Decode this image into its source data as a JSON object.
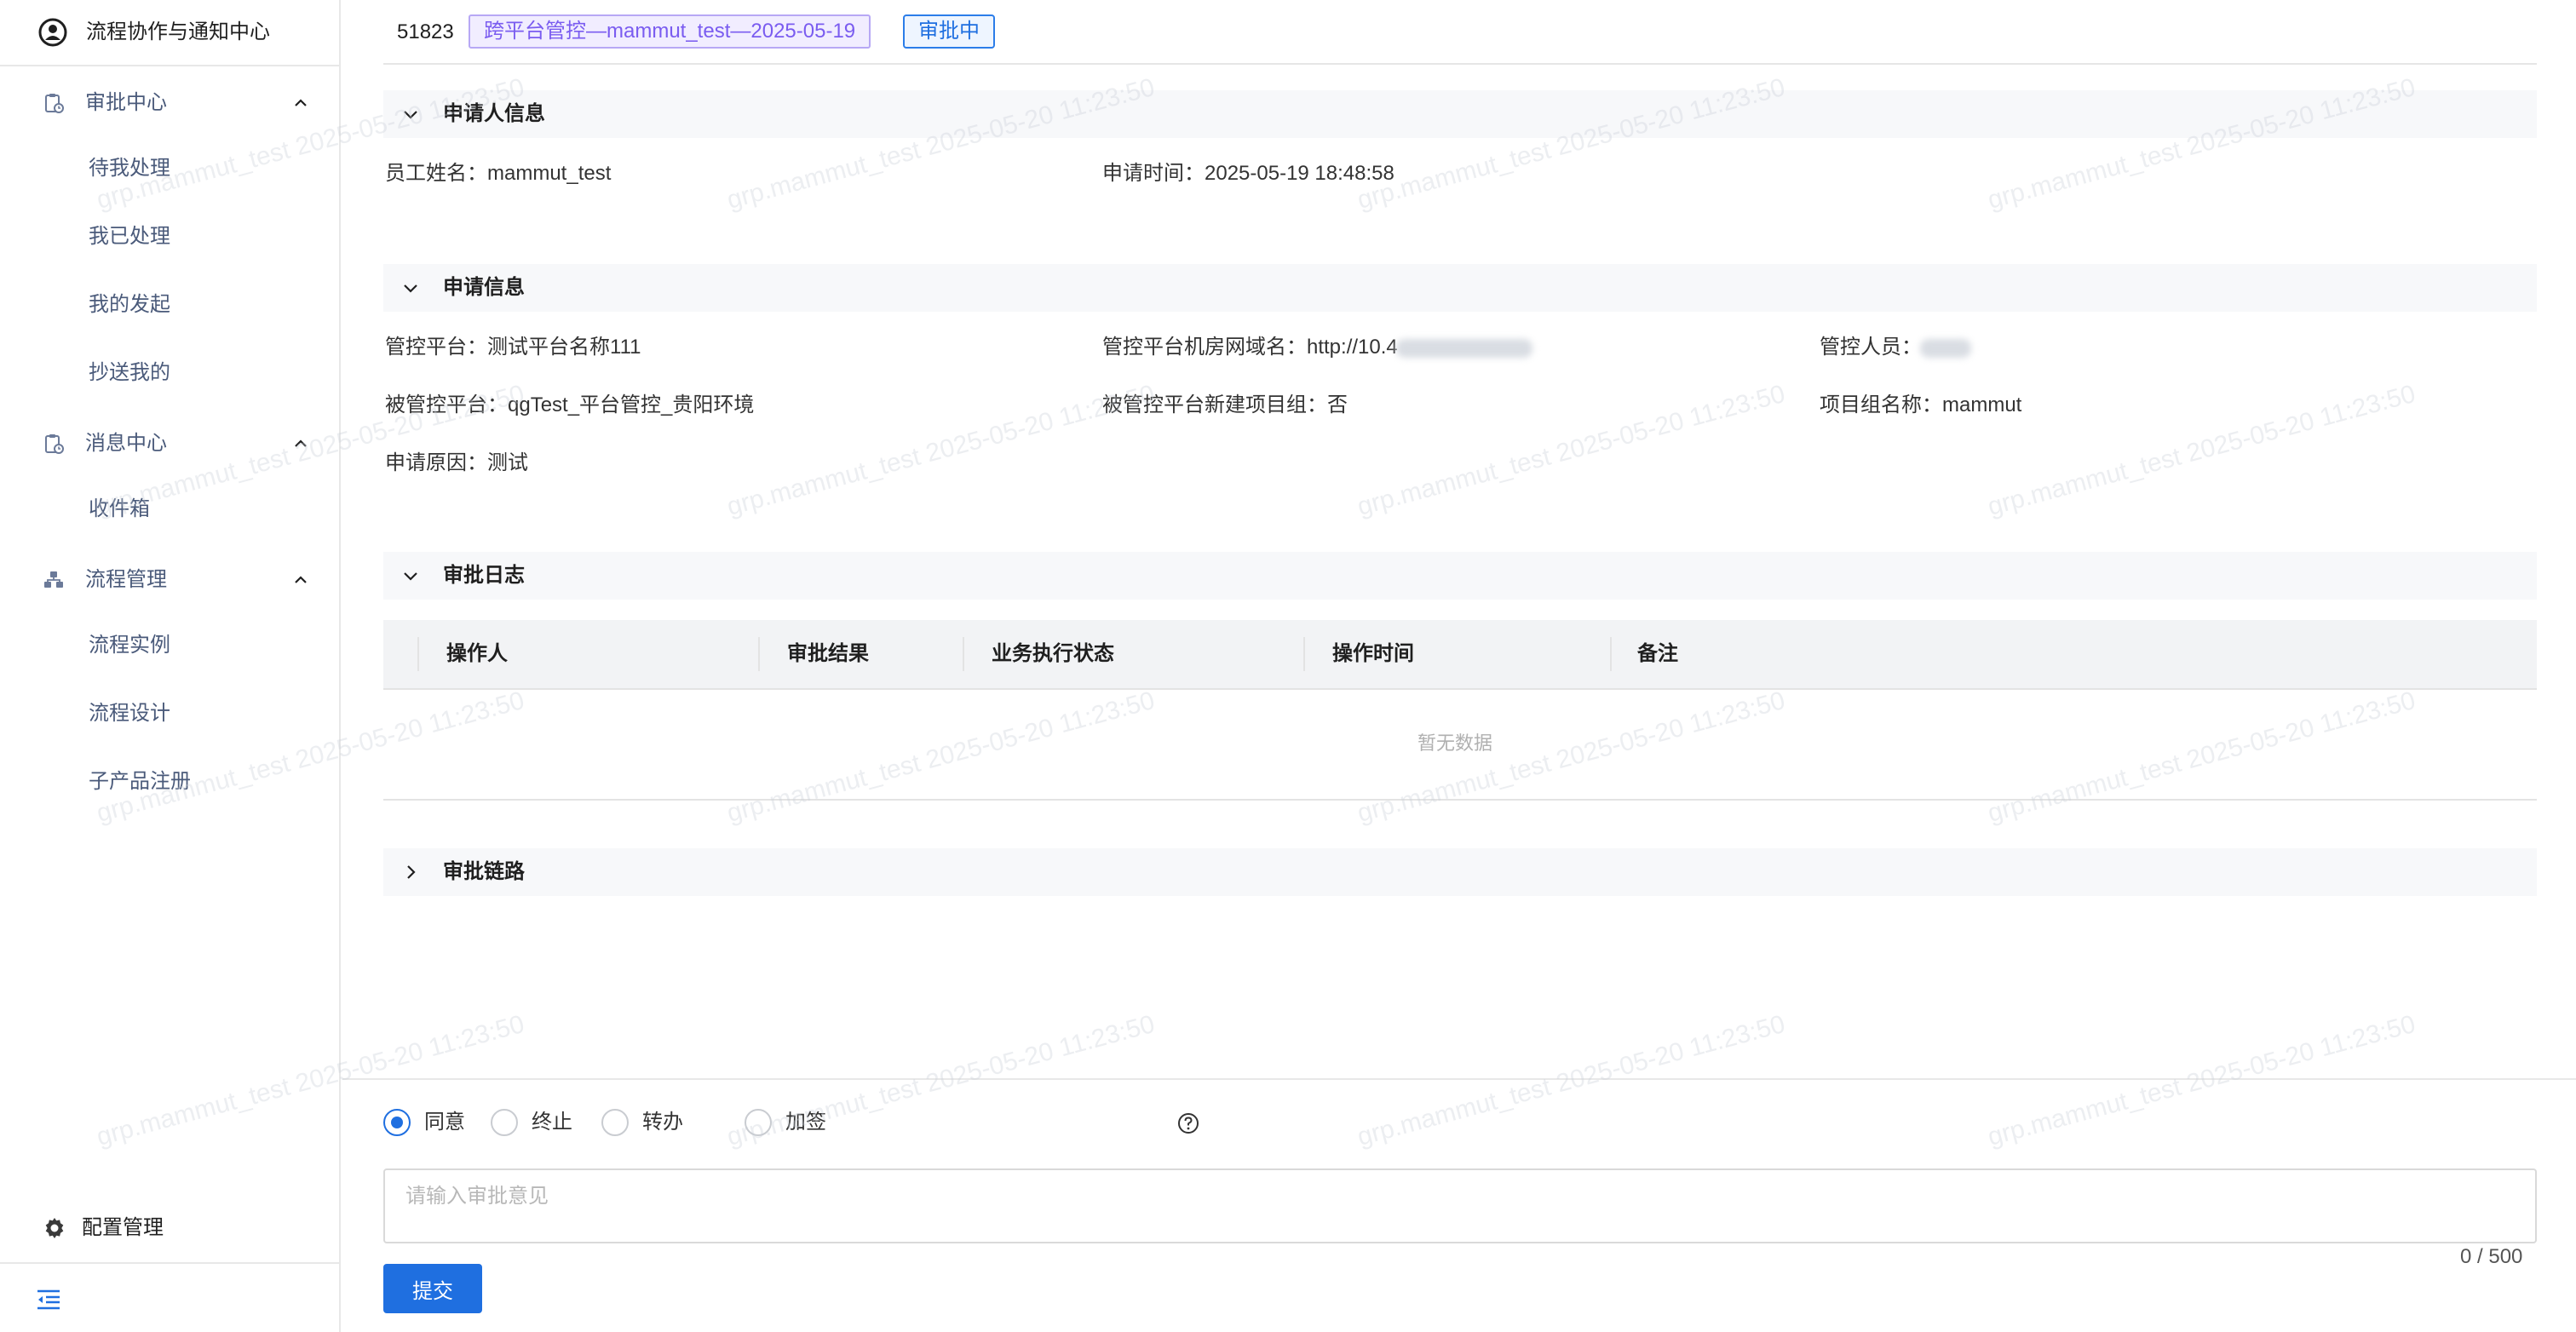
{
  "app": {
    "title": "流程协作与通知中心"
  },
  "sidebar": {
    "groups": [
      {
        "label": "审批中心",
        "icon": "clipboard-icon",
        "items": [
          {
            "label": "待我处理"
          },
          {
            "label": "我已处理"
          },
          {
            "label": "我的发起"
          },
          {
            "label": "抄送我的"
          }
        ]
      },
      {
        "label": "消息中心",
        "icon": "clipboard-icon",
        "items": [
          {
            "label": "收件箱"
          }
        ]
      },
      {
        "label": "流程管理",
        "icon": "hierarchy-icon",
        "items": [
          {
            "label": "流程实例"
          },
          {
            "label": "流程设计"
          },
          {
            "label": "子产品注册"
          }
        ]
      }
    ],
    "config": {
      "label": "配置管理",
      "icon": "gear-icon"
    },
    "collapse_icon": "menu-fold-icon"
  },
  "header": {
    "id": "51823",
    "title": "跨平台管控—mammut_test—2025-05-19",
    "status": "审批中",
    "title_color": "#7a5cf0",
    "status_color": "#1f6fe0"
  },
  "applicant": {
    "title": "申请人信息",
    "fields": [
      {
        "label": "员工姓名：",
        "value": "mammut_test"
      },
      {
        "label": "申请时间：",
        "value": "2025-05-19 18:48:58"
      }
    ]
  },
  "request": {
    "title": "申请信息",
    "fields": [
      {
        "label": "管控平台：",
        "value": "测试平台名称111"
      },
      {
        "label": "管控平台机房网域名：",
        "value": "http://10.4"
      },
      {
        "label": "管控人员：",
        "value": ""
      },
      {
        "label": "被管控平台：",
        "value": "qgTest_平台管控_贵阳环境"
      },
      {
        "label": "被管控平台新建项目组：",
        "value": "否"
      },
      {
        "label": "项目组名称：",
        "value": "mammut"
      },
      {
        "label": "申请原因：",
        "value": "测试"
      }
    ]
  },
  "log": {
    "title": "审批日志",
    "columns": [
      "操作人",
      "审批结果",
      "业务执行状态",
      "操作时间",
      "备注"
    ],
    "rows": [],
    "empty_text": "暂无数据"
  },
  "chain": {
    "title": "审批链路"
  },
  "actions": {
    "options": [
      {
        "label": "同意",
        "checked": true
      },
      {
        "label": "终止"
      },
      {
        "label": "转办"
      },
      {
        "label": "加签"
      }
    ],
    "placeholder": "请输入审批意见",
    "counter": "0 / 500",
    "submit_label": "提交",
    "accent_color": "#1f6fe0"
  },
  "watermark": "grp.mammut_test 2025-05-20 11:23:50"
}
